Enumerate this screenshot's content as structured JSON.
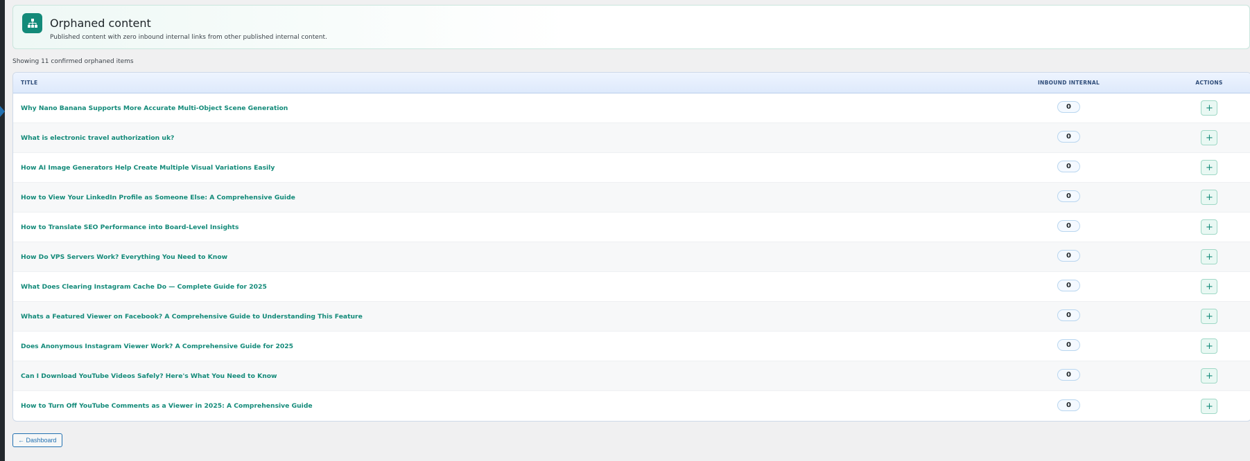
{
  "header": {
    "icon": "sitemap-icon",
    "title": "Orphaned content",
    "subtitle": "Published content with zero inbound internal links from other published internal content."
  },
  "summary": "Showing 11 confirmed orphaned items",
  "table": {
    "columns": {
      "title": "TITLE",
      "inbound": "INBOUND INTERNAL",
      "actions": "ACTIONS"
    },
    "rows": [
      {
        "title": "Why Nano Banana Supports More Accurate Multi-Object Scene Generation",
        "inbound": "0",
        "action": "+"
      },
      {
        "title": "What is electronic travel authorization uk?",
        "inbound": "0",
        "action": "+"
      },
      {
        "title": "How AI Image Generators Help Create Multiple Visual Variations Easily",
        "inbound": "0",
        "action": "+"
      },
      {
        "title": "How to View Your LinkedIn Profile as Someone Else: A Comprehensive Guide",
        "inbound": "0",
        "action": "+"
      },
      {
        "title": "How to Translate SEO Performance into Board-Level Insights",
        "inbound": "0",
        "action": "+"
      },
      {
        "title": "How Do VPS Servers Work? Everything You Need to Know",
        "inbound": "0",
        "action": "+"
      },
      {
        "title": "What Does Clearing Instagram Cache Do — Complete Guide for 2025",
        "inbound": "0",
        "action": "+"
      },
      {
        "title": "Whats a Featured Viewer on Facebook? A Comprehensive Guide to Understanding This Feature",
        "inbound": "0",
        "action": "+"
      },
      {
        "title": "Does Anonymous Instagram Viewer Work? A Comprehensive Guide for 2025",
        "inbound": "0",
        "action": "+"
      },
      {
        "title": "Can I Download YouTube Videos Safely? Here's What You Need to Know",
        "inbound": "0",
        "action": "+"
      },
      {
        "title": "How to Turn Off YouTube Comments as a Viewer in 2025: A Comprehensive Guide",
        "inbound": "0",
        "action": "+"
      }
    ]
  },
  "footer": {
    "dashboard_label": "← Dashboard"
  },
  "colors": {
    "accent": "#138a79",
    "link": "#2271b1"
  }
}
